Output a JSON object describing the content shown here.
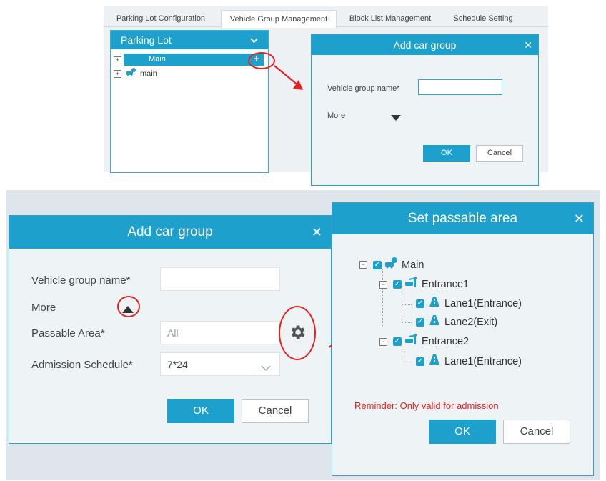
{
  "top": {
    "tabs": [
      {
        "label": "Parking Lot Configuration"
      },
      {
        "label": "Vehicle Group Management"
      },
      {
        "label": "Block List Management"
      },
      {
        "label": "Schedule Setting"
      }
    ],
    "tree_header": "Parking Lot",
    "tree": [
      {
        "label": "Main"
      },
      {
        "label": "main"
      }
    ],
    "dialog": {
      "title": "Add car group",
      "name_label": "Vehicle group name*",
      "more_label": "More",
      "ok": "OK",
      "cancel": "Cancel"
    }
  },
  "bottom": {
    "dialog": {
      "title": "Add car group",
      "name_label": "Vehicle group name*",
      "more_label": "More",
      "area_label": "Passable Area*",
      "area_value": "All",
      "schedule_label": "Admission Schedule*",
      "schedule_value": "7*24",
      "ok": "OK",
      "cancel": "Cancel"
    },
    "passable": {
      "title": "Set passable area",
      "tree": [
        {
          "label": "Main"
        },
        {
          "label": "Entrance1"
        },
        {
          "label": "Lane1(Entrance)"
        },
        {
          "label": "Lane2(Exit)"
        },
        {
          "label": "Entrance2"
        },
        {
          "label": "Lane1(Entrance)"
        }
      ],
      "reminder": "Reminder: Only valid for admission",
      "ok": "OK",
      "cancel": "Cancel"
    }
  },
  "colors": {
    "accent": "#1ea0cc",
    "annotation": "#e32222",
    "reminder": "#e32222"
  }
}
